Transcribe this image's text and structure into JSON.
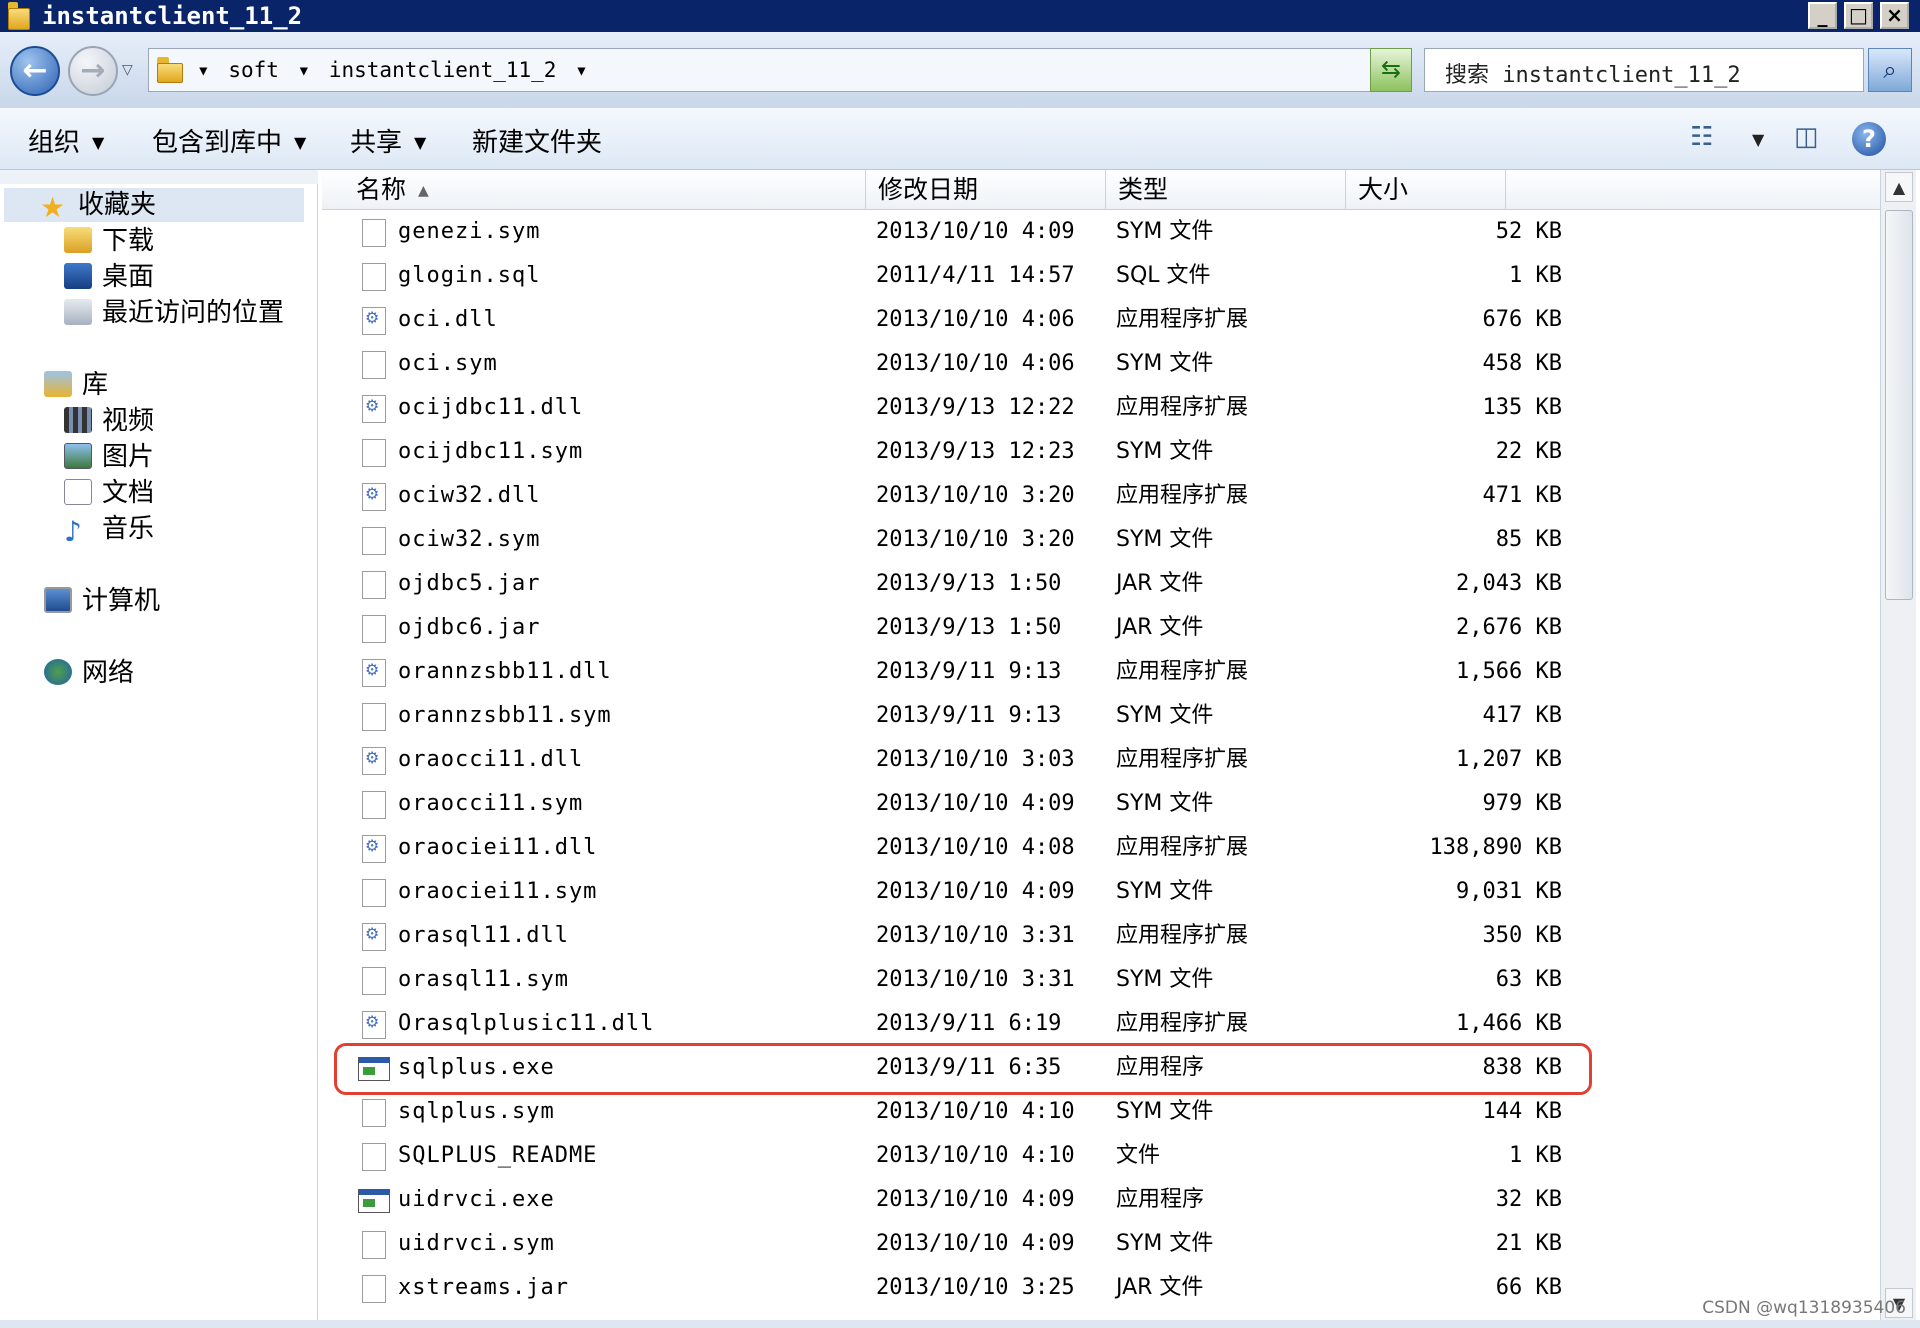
{
  "window": {
    "title": "instantclient_11_2"
  },
  "address": {
    "crumbs": [
      "soft",
      "instantclient_11_2"
    ]
  },
  "search": {
    "placeholder": "搜索 instantclient_11_2"
  },
  "commands": {
    "organize": "组织",
    "include": "包含到库中",
    "share": "共享",
    "new_folder": "新建文件夹"
  },
  "nav": {
    "favorites": "收藏夹",
    "downloads": "下载",
    "desktop": "桌面",
    "recent": "最近访问的位置",
    "libraries": "库",
    "videos": "视频",
    "pictures": "图片",
    "documents": "文档",
    "music": "音乐",
    "computer": "计算机",
    "network": "网络"
  },
  "columns": {
    "name": "名称",
    "date": "修改日期",
    "type": "类型",
    "size": "大小"
  },
  "files": [
    {
      "name": "genezi.sym",
      "date": "2013/10/10 4:09",
      "type": "SYM 文件",
      "size": "52 KB",
      "icon": "file"
    },
    {
      "name": "glogin.sql",
      "date": "2011/4/11 14:57",
      "type": "SQL 文件",
      "size": "1 KB",
      "icon": "file"
    },
    {
      "name": "oci.dll",
      "date": "2013/10/10 4:06",
      "type": "应用程序扩展",
      "size": "676 KB",
      "icon": "dll"
    },
    {
      "name": "oci.sym",
      "date": "2013/10/10 4:06",
      "type": "SYM 文件",
      "size": "458 KB",
      "icon": "file"
    },
    {
      "name": "ocijdbc11.dll",
      "date": "2013/9/13 12:22",
      "type": "应用程序扩展",
      "size": "135 KB",
      "icon": "dll"
    },
    {
      "name": "ocijdbc11.sym",
      "date": "2013/9/13 12:23",
      "type": "SYM 文件",
      "size": "22 KB",
      "icon": "file"
    },
    {
      "name": "ociw32.dll",
      "date": "2013/10/10 3:20",
      "type": "应用程序扩展",
      "size": "471 KB",
      "icon": "dll"
    },
    {
      "name": "ociw32.sym",
      "date": "2013/10/10 3:20",
      "type": "SYM 文件",
      "size": "85 KB",
      "icon": "file"
    },
    {
      "name": "ojdbc5.jar",
      "date": "2013/9/13 1:50",
      "type": "JAR 文件",
      "size": "2,043 KB",
      "icon": "file"
    },
    {
      "name": "ojdbc6.jar",
      "date": "2013/9/13 1:50",
      "type": "JAR 文件",
      "size": "2,676 KB",
      "icon": "file"
    },
    {
      "name": "orannzsbb11.dll",
      "date": "2013/9/11 9:13",
      "type": "应用程序扩展",
      "size": "1,566 KB",
      "icon": "dll"
    },
    {
      "name": "orannzsbb11.sym",
      "date": "2013/9/11 9:13",
      "type": "SYM 文件",
      "size": "417 KB",
      "icon": "file"
    },
    {
      "name": "oraocci11.dll",
      "date": "2013/10/10 3:03",
      "type": "应用程序扩展",
      "size": "1,207 KB",
      "icon": "dll"
    },
    {
      "name": "oraocci11.sym",
      "date": "2013/10/10 4:09",
      "type": "SYM 文件",
      "size": "979 KB",
      "icon": "file"
    },
    {
      "name": "oraociei11.dll",
      "date": "2013/10/10 4:08",
      "type": "应用程序扩展",
      "size": "138,890 KB",
      "icon": "dll"
    },
    {
      "name": "oraociei11.sym",
      "date": "2013/10/10 4:09",
      "type": "SYM 文件",
      "size": "9,031 KB",
      "icon": "file"
    },
    {
      "name": "orasql11.dll",
      "date": "2013/10/10 3:31",
      "type": "应用程序扩展",
      "size": "350 KB",
      "icon": "dll"
    },
    {
      "name": "orasql11.sym",
      "date": "2013/10/10 3:31",
      "type": "SYM 文件",
      "size": "63 KB",
      "icon": "file"
    },
    {
      "name": "Orasqlplusic11.dll",
      "date": "2013/9/11 6:19",
      "type": "应用程序扩展",
      "size": "1,466 KB",
      "icon": "dll"
    },
    {
      "name": "sqlplus.exe",
      "date": "2013/9/11 6:35",
      "type": "应用程序",
      "size": "838 KB",
      "icon": "exe",
      "highlight": true
    },
    {
      "name": "sqlplus.sym",
      "date": "2013/10/10 4:10",
      "type": "SYM 文件",
      "size": "144 KB",
      "icon": "file"
    },
    {
      "name": "SQLPLUS_README",
      "date": "2013/10/10 4:10",
      "type": "文件",
      "size": "1 KB",
      "icon": "file"
    },
    {
      "name": "uidrvci.exe",
      "date": "2013/10/10 4:09",
      "type": "应用程序",
      "size": "32 KB",
      "icon": "exe"
    },
    {
      "name": "uidrvci.sym",
      "date": "2013/10/10 4:09",
      "type": "SYM 文件",
      "size": "21 KB",
      "icon": "file"
    },
    {
      "name": "xstreams.jar",
      "date": "2013/10/10 3:25",
      "type": "JAR 文件",
      "size": "66 KB",
      "icon": "file"
    }
  ],
  "watermark": "CSDN @wq1318935406",
  "colors": {
    "titlebar": "#0a246a",
    "highlight": "#e0402f"
  }
}
